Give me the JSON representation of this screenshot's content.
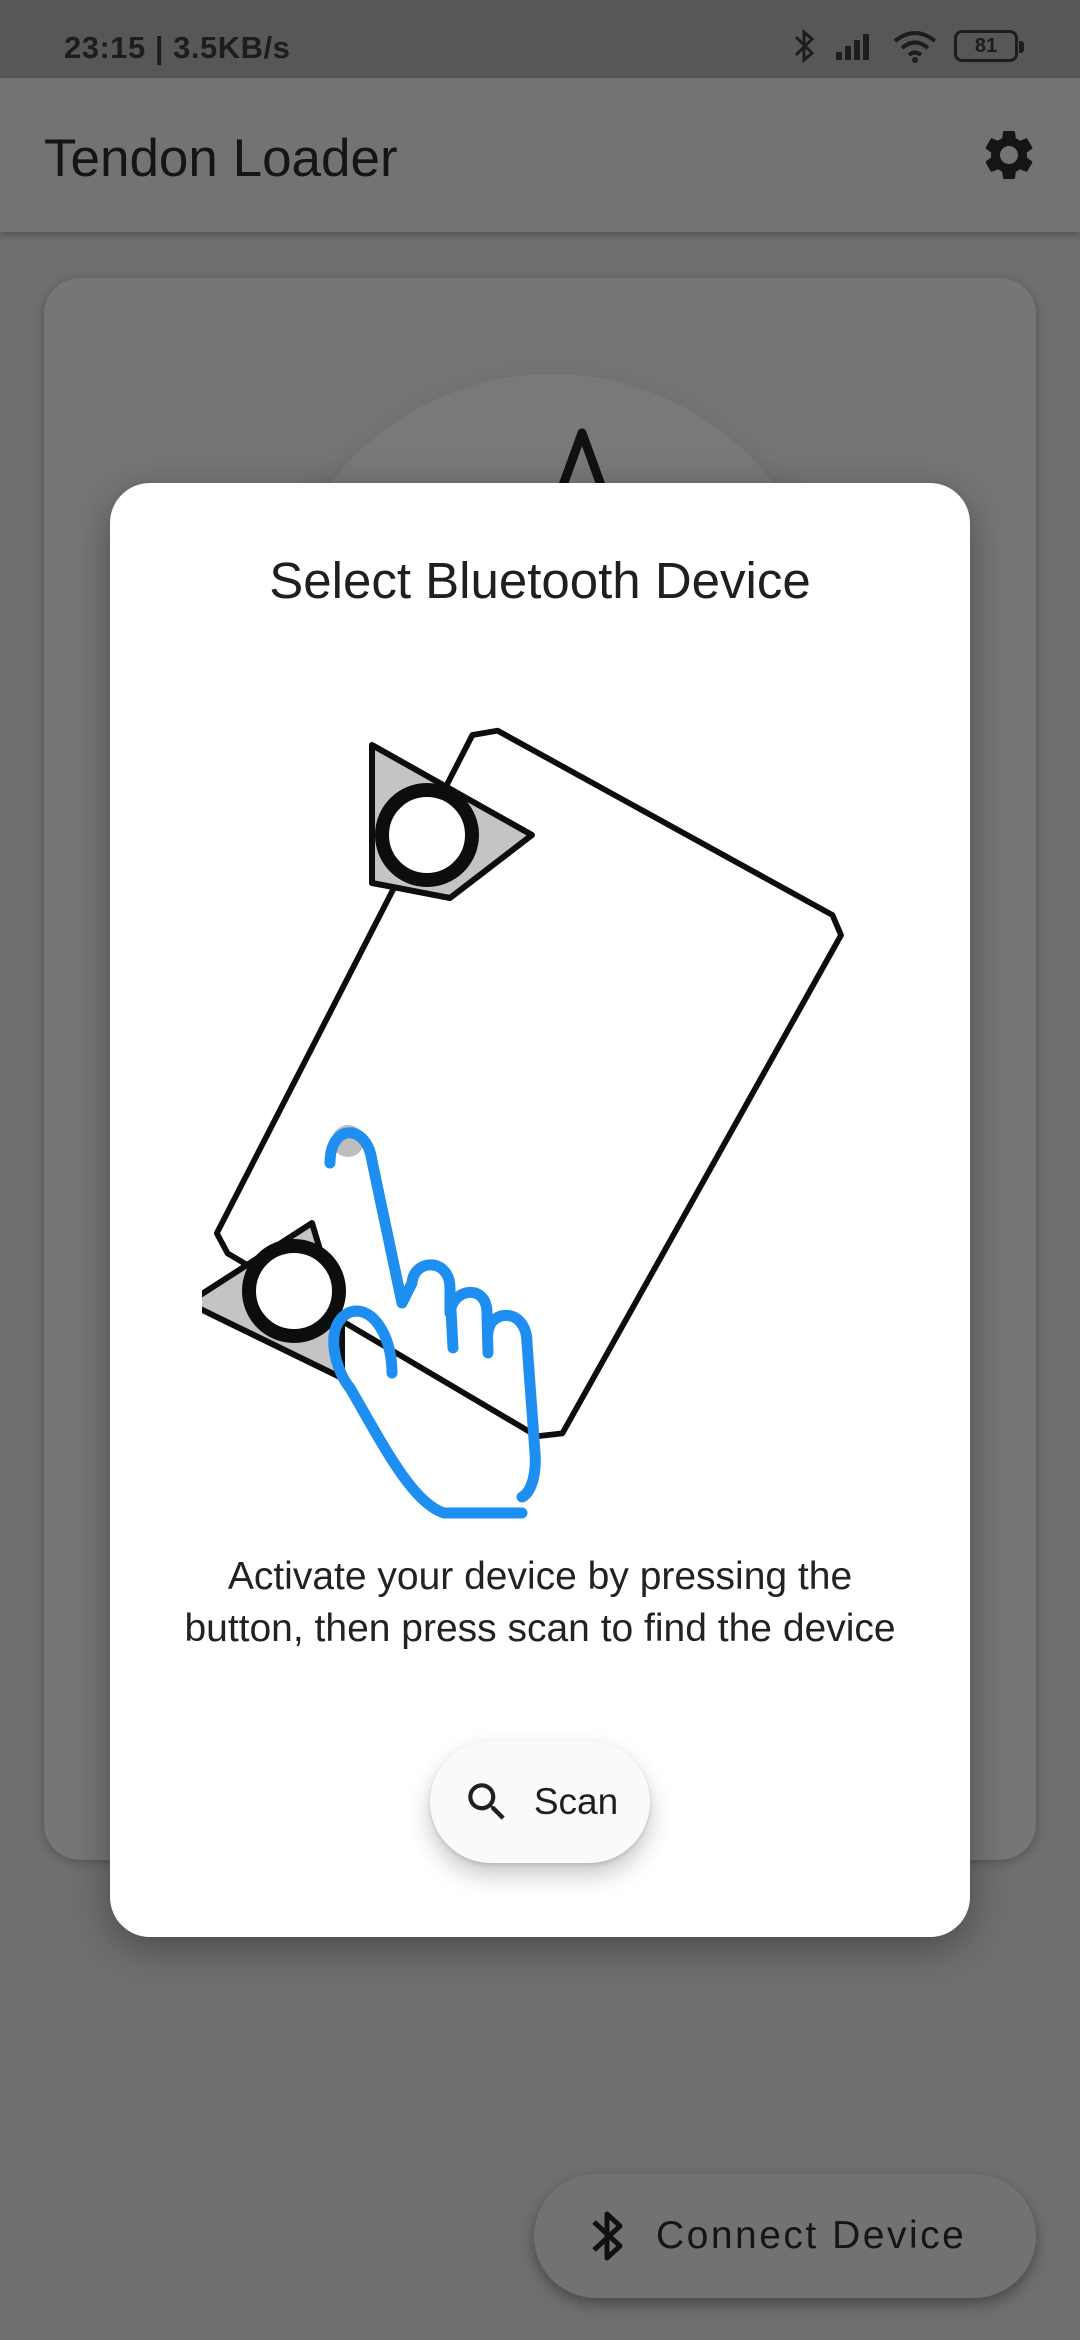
{
  "status_bar": {
    "time": "23:15 | 3.5KB/s",
    "battery": "81",
    "icons": [
      "bluetooth-icon",
      "signal-icon",
      "wifi-icon",
      "battery-icon"
    ]
  },
  "app_bar": {
    "title": "Tendon Loader",
    "settings_icon": "gear-icon"
  },
  "dialog": {
    "title": "Select Bluetooth Device",
    "message": "Activate your device by pressing the button, then press scan to find the device",
    "scan_label": "Scan",
    "scan_icon": "search-icon",
    "illustration": "hand-pressing-device-button"
  },
  "fab": {
    "label": "Connect Device",
    "icon": "bluetooth-icon"
  },
  "colors": {
    "accent_blue": "#1e8ff0",
    "scrim": "#6f6f6f",
    "dialog_bg": "#ffffff"
  }
}
